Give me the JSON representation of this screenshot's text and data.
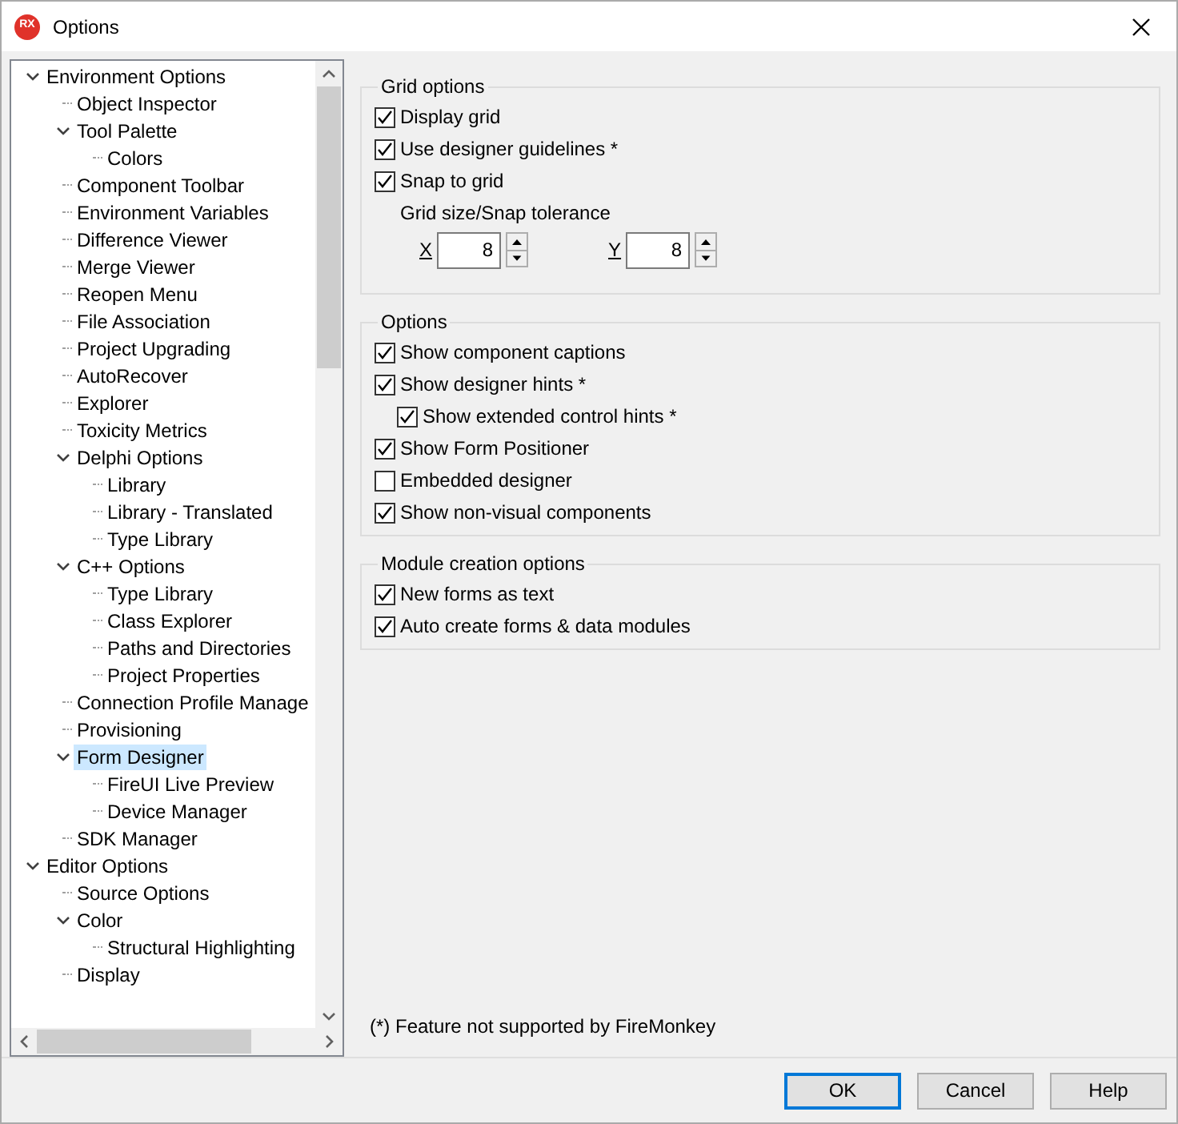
{
  "window": {
    "title": "Options",
    "logo": "RX"
  },
  "tree": [
    {
      "label": "Environment Options",
      "expanded": true,
      "selected": false,
      "children": [
        {
          "label": "Object Inspector",
          "selected": false
        },
        {
          "label": "Tool Palette",
          "expanded": true,
          "selected": false,
          "children": [
            {
              "label": "Colors",
              "selected": false
            }
          ]
        },
        {
          "label": "Component Toolbar",
          "selected": false
        },
        {
          "label": "Environment Variables",
          "selected": false
        },
        {
          "label": "Difference Viewer",
          "selected": false
        },
        {
          "label": "Merge Viewer",
          "selected": false
        },
        {
          "label": "Reopen Menu",
          "selected": false
        },
        {
          "label": "File Association",
          "selected": false
        },
        {
          "label": "Project Upgrading",
          "selected": false
        },
        {
          "label": "AutoRecover",
          "selected": false
        },
        {
          "label": "Explorer",
          "selected": false
        },
        {
          "label": "Toxicity Metrics",
          "selected": false
        },
        {
          "label": "Delphi Options",
          "expanded": true,
          "selected": false,
          "children": [
            {
              "label": "Library",
              "selected": false
            },
            {
              "label": "Library - Translated",
              "selected": false
            },
            {
              "label": "Type Library",
              "selected": false
            }
          ]
        },
        {
          "label": "C++ Options",
          "expanded": true,
          "selected": false,
          "children": [
            {
              "label": "Type Library",
              "selected": false
            },
            {
              "label": "Class Explorer",
              "selected": false
            },
            {
              "label": "Paths and Directories",
              "selected": false
            },
            {
              "label": "Project Properties",
              "selected": false
            }
          ]
        },
        {
          "label": "Connection Profile Manage",
          "selected": false
        },
        {
          "label": "Provisioning",
          "selected": false
        },
        {
          "label": "Form Designer",
          "expanded": true,
          "selected": true,
          "children": [
            {
              "label": "FireUI Live Preview",
              "selected": false
            },
            {
              "label": "Device Manager",
              "selected": false
            }
          ]
        },
        {
          "label": "SDK Manager",
          "selected": false
        }
      ]
    },
    {
      "label": "Editor Options",
      "expanded": true,
      "selected": false,
      "children": [
        {
          "label": "Source Options",
          "selected": false
        },
        {
          "label": "Color",
          "expanded": true,
          "selected": false,
          "children": [
            {
              "label": "Structural Highlighting",
              "selected": false
            }
          ]
        },
        {
          "label": "Display",
          "selected": false
        }
      ]
    }
  ],
  "groups": [
    {
      "title": "Grid options",
      "items": [
        {
          "kind": "checkbox",
          "label": "Display grid",
          "checked": true
        },
        {
          "kind": "checkbox",
          "label": "Use designer guidelines *",
          "checked": true
        },
        {
          "kind": "checkbox",
          "label": "Snap to grid",
          "checked": true
        },
        {
          "kind": "label",
          "label": "Grid size/Snap tolerance"
        },
        {
          "kind": "spinners",
          "fields": [
            {
              "label": "X",
              "value": "8"
            },
            {
              "label": "Y",
              "value": "8"
            }
          ]
        }
      ]
    },
    {
      "title": "Options",
      "items": [
        {
          "kind": "checkbox",
          "label": "Show component captions",
          "checked": true
        },
        {
          "kind": "checkbox",
          "label": "Show designer hints *",
          "checked": true,
          "children": [
            {
              "kind": "checkbox",
              "label": "Show extended control hints *",
              "checked": true
            }
          ]
        },
        {
          "kind": "checkbox",
          "label": "Show Form Positioner",
          "checked": true
        },
        {
          "kind": "checkbox",
          "label": "Embedded designer",
          "checked": false
        },
        {
          "kind": "checkbox",
          "label": "Show non-visual components",
          "checked": true
        }
      ]
    },
    {
      "title": "Module creation options",
      "items": [
        {
          "kind": "checkbox",
          "label": "New forms as text",
          "checked": true
        },
        {
          "kind": "checkbox",
          "label": "Auto create forms & data modules",
          "checked": true
        }
      ]
    }
  ],
  "footnote": "(*) Feature not supported by FireMonkey",
  "buttons": [
    {
      "label": "OK",
      "default": true
    },
    {
      "label": "Cancel",
      "default": false
    },
    {
      "label": "Help",
      "default": false
    }
  ]
}
